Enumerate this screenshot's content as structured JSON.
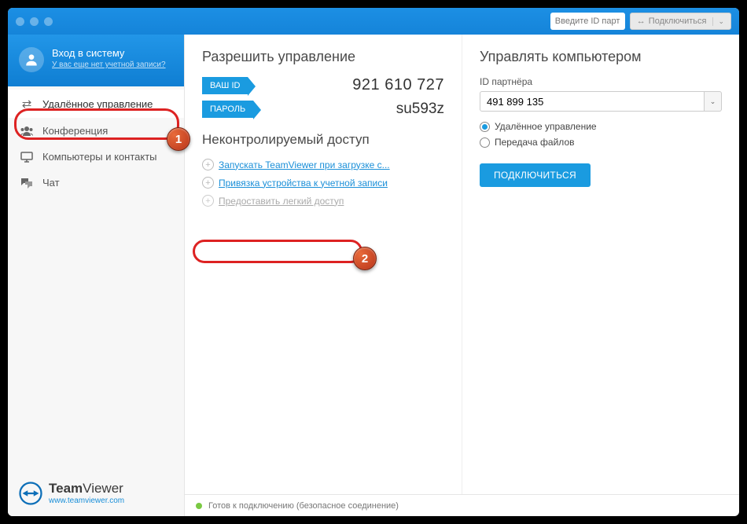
{
  "titlebar": {
    "partner_id_placeholder": "Введите ID партн",
    "connect_label": "Подключиться"
  },
  "sidebar": {
    "login_title": "Вход в систему",
    "login_subtitle": "У вас еще нет учетной записи?",
    "items": [
      {
        "label": "Удалённое управление"
      },
      {
        "label": "Конференция"
      },
      {
        "label": "Компьютеры и контакты"
      },
      {
        "label": "Чат"
      }
    ],
    "brand_bold": "Team",
    "brand_regular": "Viewer",
    "brand_url": "www.teamviewer.com"
  },
  "allow": {
    "heading": "Разрешить управление",
    "id_tag": "ВАШ ID",
    "id_value": "921 610 727",
    "pw_tag": "ПАРОЛЬ",
    "pw_value": "su593z"
  },
  "unattended": {
    "heading": "Неконтролируемый доступ",
    "links": [
      "Запускать TeamViewer при загрузке с...",
      "Привязка устройства к учетной записи",
      "Предоставить легкий доступ"
    ]
  },
  "control": {
    "heading": "Управлять компьютером",
    "partner_label": "ID партнёра",
    "partner_value": "491 899 135",
    "radio_remote": "Удалённое управление",
    "radio_files": "Передача файлов",
    "connect_button": "ПОДКЛЮЧИТЬСЯ"
  },
  "status": {
    "text": "Готов к подключению (безопасное соединение)"
  },
  "annotations": {
    "badge1": "1",
    "badge2": "2"
  }
}
